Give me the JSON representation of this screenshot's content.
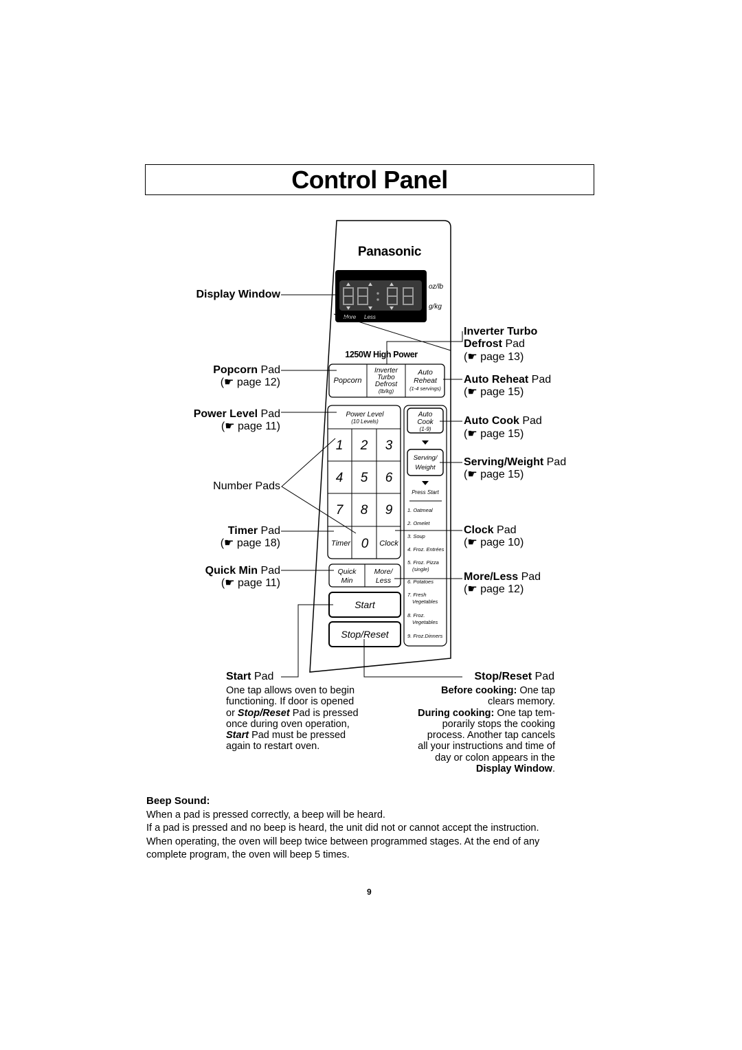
{
  "page": {
    "title": "Control Panel",
    "page_number": "9"
  },
  "panel": {
    "brand": "Panasonic",
    "display": {
      "digits": "88:88",
      "unit_top": "oz/lb",
      "unit_bottom": "g/kg",
      "more": "More",
      "less": "Less"
    },
    "power_rating": "1250W High Power",
    "pads": {
      "popcorn": "Popcorn",
      "inverter": [
        "Inverter",
        "Turbo",
        "Defrost",
        "(lb/kg)"
      ],
      "auto_reheat": [
        "Auto",
        "Reheat",
        "(1-4 servings)"
      ],
      "power_level": [
        "Power Level",
        "(10 Levels)"
      ],
      "auto_cook": [
        "Auto",
        "Cook",
        "(1-9)"
      ],
      "numbers": [
        "1",
        "2",
        "3",
        "4",
        "5",
        "6",
        "7",
        "8",
        "9"
      ],
      "timer": "Timer",
      "zero": "0",
      "clock": "Clock",
      "serving_weight": [
        "Serving/",
        "Weight"
      ],
      "press_start": "Press Start",
      "quick_min": [
        "Quick",
        "Min"
      ],
      "more_less": [
        "More/",
        "Less"
      ],
      "start": "Start",
      "stop_reset": "Stop/Reset"
    },
    "auto_cook_menu": [
      [
        "1. Oatmeal"
      ],
      [
        "2. Omelet"
      ],
      [
        "3. Soup"
      ],
      [
        "4. Froz. Entrées"
      ],
      [
        "5. Froz. Pizza",
        "(single)"
      ],
      [
        "6. Potatoes"
      ],
      [
        "7. Fresh",
        "Vegetables"
      ],
      [
        "8. Froz.",
        "Vegetables"
      ],
      [
        "9. Froz.Dinners"
      ]
    ]
  },
  "callouts": {
    "display_window": "Display Window",
    "popcorn": {
      "bold": "Popcorn",
      "rest": " Pad",
      "page": "(☛ page 12)"
    },
    "power_level": {
      "bold": "Power Level",
      "rest": " Pad",
      "page": "(☛ page 11)"
    },
    "number_pads": "Number Pads",
    "timer": {
      "bold": "Timer",
      "rest": " Pad",
      "page": "(☛ page 18)"
    },
    "quick_min": {
      "bold": "Quick Min",
      "rest": " Pad",
      "page": "(☛ page 11)"
    },
    "inverter": {
      "bold1": "Inverter Turbo",
      "bold2": "Defrost",
      "rest": " Pad",
      "page": "(☛ page 13)"
    },
    "auto_reheat": {
      "bold": "Auto Reheat",
      "rest": " Pad",
      "page": "(☛ page 15)"
    },
    "auto_cook": {
      "bold": "Auto Cook",
      "rest": " Pad",
      "page": "(☛ page 15)"
    },
    "serving_weight": {
      "bold": "Serving/Weight",
      "rest": " Pad",
      "page": "(☛ page 15)"
    },
    "clock": {
      "bold": "Clock",
      "rest": " Pad",
      "page": "(☛ page 10)"
    },
    "more_less": {
      "bold": "More/Less",
      "rest": " Pad",
      "page": "(☛ page 12)"
    },
    "start": {
      "bold": "Start",
      "rest": " Pad"
    },
    "stop_reset": {
      "bold": "Stop/Reset",
      "rest": " Pad"
    }
  },
  "start_desc": {
    "l1": "One tap allows oven to begin",
    "l2": "functioning. If door is opened",
    "l3a": "or ",
    "l3b": "Stop/Reset",
    "l3c": " Pad is pressed",
    "l4": "once during oven operation,",
    "l5a": "Start",
    "l5b": " Pad must be pressed",
    "l6": "again to restart oven."
  },
  "stop_desc": {
    "l1a": "Before cooking:",
    "l1b": " One tap",
    "l2": "clears memory.",
    "l3a": "During cooking:",
    "l3b": " One tap tem-",
    "l4": "porarily stops the cooking",
    "l5": "process. Another tap cancels",
    "l6": "all your instructions and time of",
    "l7": "day or colon appears in the",
    "l8": "Display Window",
    "l8b": "."
  },
  "beep": {
    "heading": "Beep Sound:",
    "p1": "When a pad is pressed correctly, a beep will be heard.",
    "p2": "If a pad is pressed and no beep is heard, the unit did not or cannot accept the instruction.",
    "p3": "When operating, the oven will beep twice between programmed stages. At the end of any",
    "p4": "complete program, the oven will beep 5 times."
  }
}
